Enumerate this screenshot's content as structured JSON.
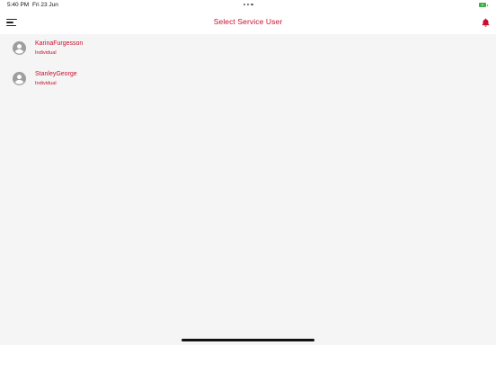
{
  "status_bar": {
    "time": "5:40 PM",
    "date": "Fri 23 Jun",
    "battery_color": "#3cb043"
  },
  "header": {
    "title": "Select Service User",
    "menu_icon": "hamburger-menu-icon",
    "notification_icon": "bell-icon"
  },
  "service_users": [
    {
      "name": "KarinaFurgesson",
      "type": "Individual",
      "icon": "user-avatar-icon"
    },
    {
      "name": "StanleyGeorge",
      "type": "Individual",
      "icon": "user-avatar-icon"
    }
  ],
  "colors": {
    "accent": "#c8102e",
    "background": "#f5f5f5"
  }
}
